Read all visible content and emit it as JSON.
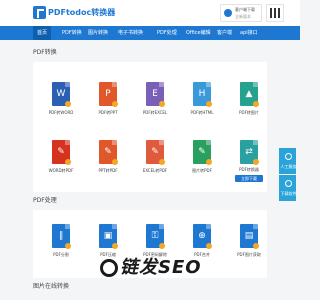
{
  "header": {
    "brand": "PDFtodoc转换器",
    "service_line1": "客户端下载",
    "service_line2": "全新版本"
  },
  "nav": {
    "items": [
      "首页",
      "PDF转换",
      "图片转换",
      "电子书转换",
      "PDF处理",
      "Office编辑",
      "客户端",
      "api接口"
    ]
  },
  "sections": {
    "pdf_convert": {
      "title": "PDF转换",
      "row1": [
        {
          "label": "PDF转WORD",
          "letter": "W",
          "color": "#2b5fb4"
        },
        {
          "label": "PDF转PPT",
          "letter": "P",
          "color": "#e0572a"
        },
        {
          "label": "PDF转EXCEL",
          "letter": "E",
          "color": "#7a5fb8"
        },
        {
          "label": "PDF转HTML",
          "letter": "H",
          "color": "#3a9ad9"
        },
        {
          "label": "PDF转图片",
          "letter": "▲",
          "color": "#24a28e"
        }
      ],
      "row2": [
        {
          "label": "WORD转PDF",
          "letter": "✎",
          "color": "#d6331f"
        },
        {
          "label": "PPT转PDF",
          "letter": "✎",
          "color": "#e0572a"
        },
        {
          "label": "EXCEL转PDF",
          "letter": "✎",
          "color": "#e05a3e"
        },
        {
          "label": "图片转PDF",
          "letter": "✎",
          "color": "#2aa060"
        },
        {
          "label": "PDF转换器",
          "letter": "⇄",
          "color": "#2aa0a0",
          "pill": "立即下载"
        }
      ]
    },
    "pdf_process": {
      "title": "PDF处理",
      "row1": [
        {
          "label": "PDF分割",
          "letter": "∥",
          "color": "#1e78d2"
        },
        {
          "label": "PDF压缩",
          "letter": "▣",
          "color": "#1e78d2"
        },
        {
          "label": "PDF密码解除",
          "letter": "⚿",
          "color": "#1e78d2"
        },
        {
          "label": "PDF合并",
          "letter": "⊕",
          "color": "#1e78d2"
        },
        {
          "label": "PDF图片获取",
          "letter": "▤",
          "color": "#1e78d2"
        }
      ]
    },
    "image_convert": {
      "title": "图片在线转换"
    }
  },
  "float_buttons": [
    {
      "label": "人工服务"
    },
    {
      "label": "下载软件"
    }
  ],
  "watermark": "链发SEO"
}
